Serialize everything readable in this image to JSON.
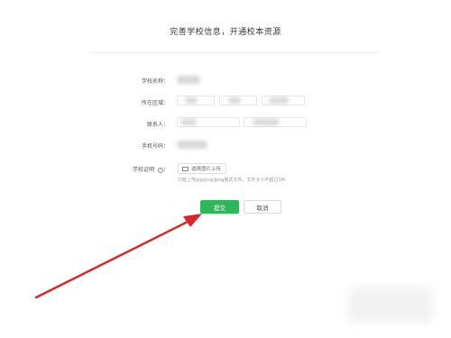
{
  "form": {
    "title": "完善学校信息，开通校本资源",
    "labels": {
      "school_name": "学校名称",
      "region": "所在区域",
      "contact": "联系人",
      "phone": "手机号码",
      "certificate": "学校证明"
    },
    "upload_label": "选择图片上传",
    "upload_hint": "只能上传jpg/png/jpeg格式文件，文件大小不超过1M",
    "help_icon_glyph": "?",
    "submit_label": "提交",
    "cancel_label": "取消"
  },
  "colors": {
    "submit": "#2fb65a",
    "arrow": "#d8262a"
  },
  "icons": {
    "upload": "image-icon",
    "help": "help-icon"
  }
}
